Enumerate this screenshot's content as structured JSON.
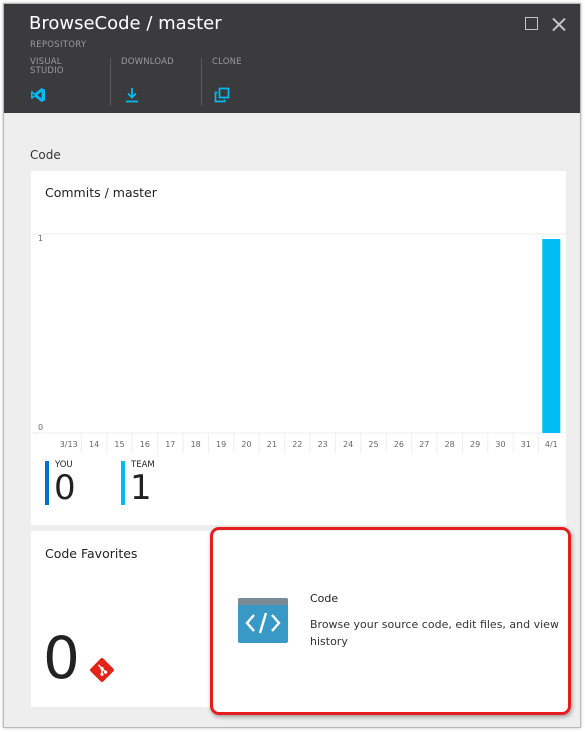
{
  "header": {
    "title": "BrowseCode / master",
    "subtitle": "REPOSITORY",
    "commands": [
      {
        "label": "VISUAL\nSTUDIO",
        "icon": "visual-studio-icon"
      },
      {
        "label": "DOWNLOAD",
        "icon": "download-icon"
      },
      {
        "label": "CLONE",
        "icon": "clone-icon"
      }
    ]
  },
  "section": {
    "label": "Code"
  },
  "commits": {
    "title": "Commits / master",
    "stats": {
      "you_label": "YOU",
      "you_value": "0",
      "team_label": "TEAM",
      "team_value": "1"
    }
  },
  "chart_data": {
    "type": "bar",
    "title": "Commits / master",
    "categories": [
      "3/13",
      "14",
      "15",
      "16",
      "17",
      "18",
      "19",
      "20",
      "21",
      "22",
      "23",
      "24",
      "25",
      "26",
      "27",
      "28",
      "29",
      "30",
      "31",
      "4/1"
    ],
    "values": [
      0,
      0,
      0,
      0,
      0,
      0,
      0,
      0,
      0,
      0,
      0,
      0,
      0,
      0,
      0,
      0,
      0,
      0,
      0,
      1
    ],
    "ylim": [
      0,
      1
    ],
    "yticks": [
      "0",
      "1"
    ],
    "bar_color": "#00bcf2",
    "grid": true
  },
  "favorites": {
    "title": "Code Favorites",
    "count": "0",
    "icon": "git-icon"
  },
  "code_tile": {
    "title": "Code",
    "description": "Browse your source code, edit files, and view history",
    "icon": "code-icon"
  },
  "colors": {
    "accent": "#00bcf2",
    "you_bar": "#0072c6",
    "header_bg": "#3b3b3e",
    "highlight": "#e41e1e",
    "git": "#e2231a"
  }
}
